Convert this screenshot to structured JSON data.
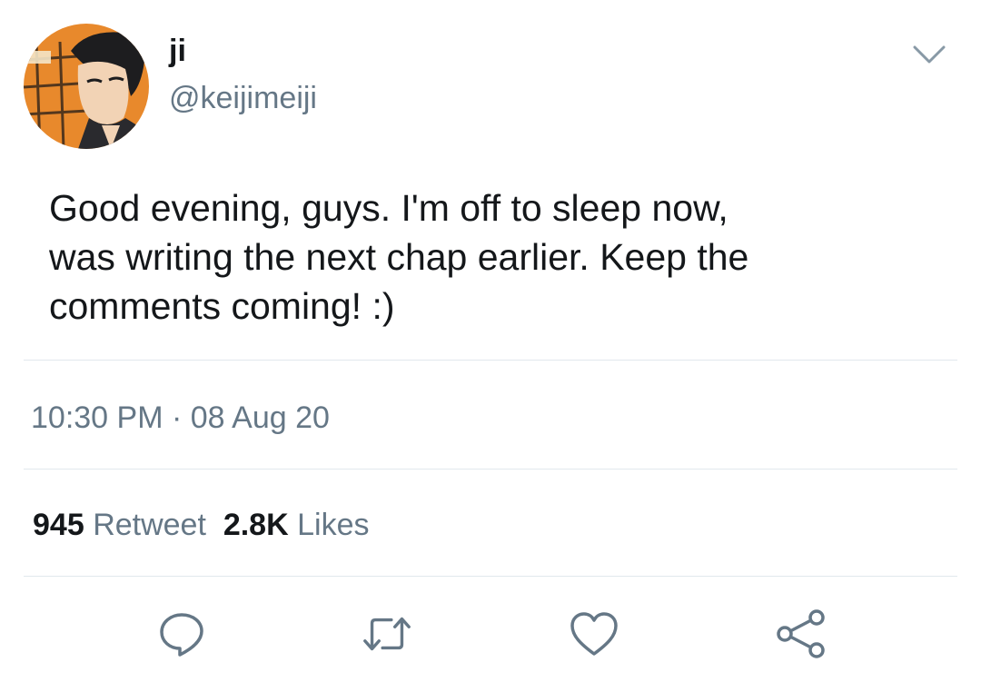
{
  "user": {
    "display_name": "ji",
    "handle": "@keijimeiji",
    "avatar_icon": "anime-character-avatar"
  },
  "tweet": {
    "text": "Good evening, guys. I'm off to sleep now,\nwas writing the next chap earlier. Keep the\ncomments coming! :)",
    "time": "10:30 PM",
    "separator": "·",
    "date": "08 Aug 20"
  },
  "stats": {
    "retweet_count": "945",
    "retweet_label": "Retweet",
    "like_count": "2.8K",
    "like_label": "Likes"
  },
  "actions": {
    "reply_icon": "reply-icon",
    "retweet_icon": "retweet-icon",
    "like_icon": "heart-icon",
    "share_icon": "share-icon"
  },
  "colors": {
    "text_primary": "#14171a",
    "text_secondary": "#657786",
    "divider": "#e1e8ed"
  }
}
